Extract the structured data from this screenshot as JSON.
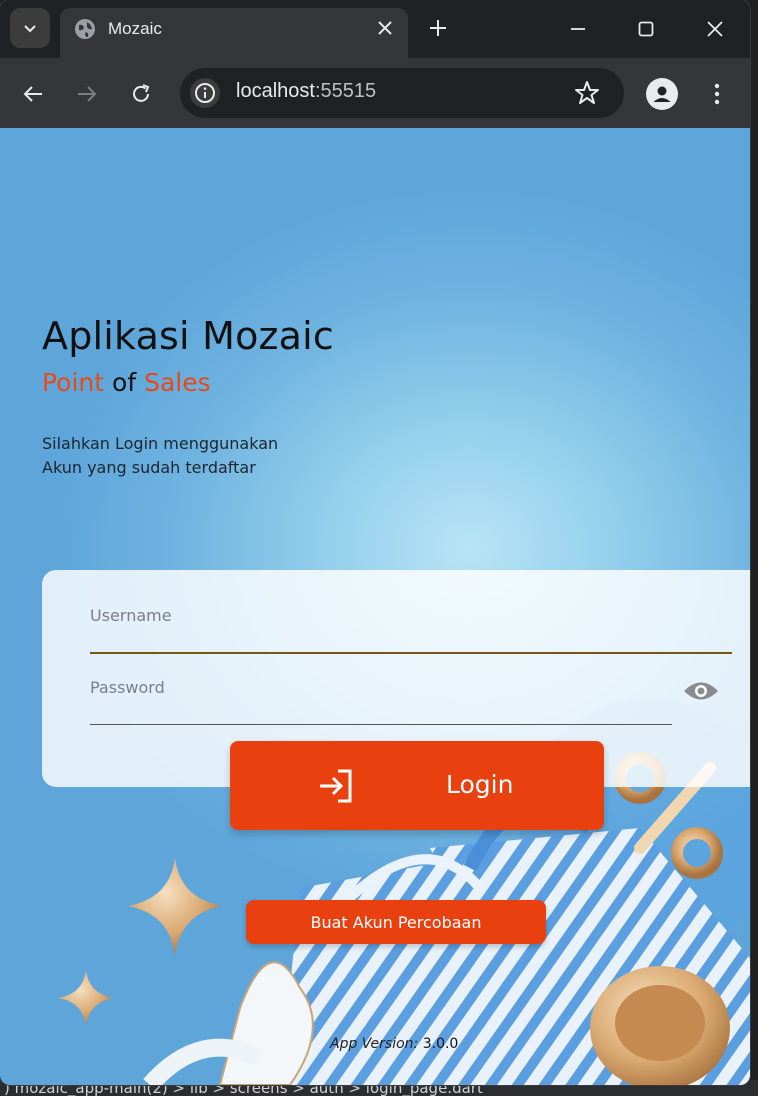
{
  "browser": {
    "tab_title": "Mozaic",
    "url_host": "localhost",
    "url_port": ":55515"
  },
  "app": {
    "title": "Aplikasi Mozaic",
    "subtitle_word1": "Point",
    "subtitle_word2": " of ",
    "subtitle_word3": "Sales",
    "desc_line1": "Silahkan Login menggunakan",
    "desc_line2": "Akun yang sudah terdaftar"
  },
  "form": {
    "username_label": "Username",
    "password_label": "Password",
    "login_label": "Login",
    "trial_label": "Buat Akun Percobaan"
  },
  "footer": {
    "version_label": "App Version:",
    "version_value": " 3.0.0"
  },
  "ide": {
    "breadcrumb": ") mozaic_app-main(2)  >  lib  >  screens  >  auth  >  login_page.dart"
  },
  "colors": {
    "accent": "#e8400f",
    "accent_text": "#e64a19",
    "underline_active": "#7a5317"
  },
  "icons": [
    "chevron-down-icon",
    "globe-icon",
    "close-icon",
    "plus-icon",
    "minimize-icon",
    "maximize-icon",
    "back-icon",
    "forward-icon",
    "reload-icon",
    "info-icon",
    "star-icon",
    "profile-icon",
    "kebab-menu-icon",
    "eye-icon",
    "login-icon"
  ]
}
